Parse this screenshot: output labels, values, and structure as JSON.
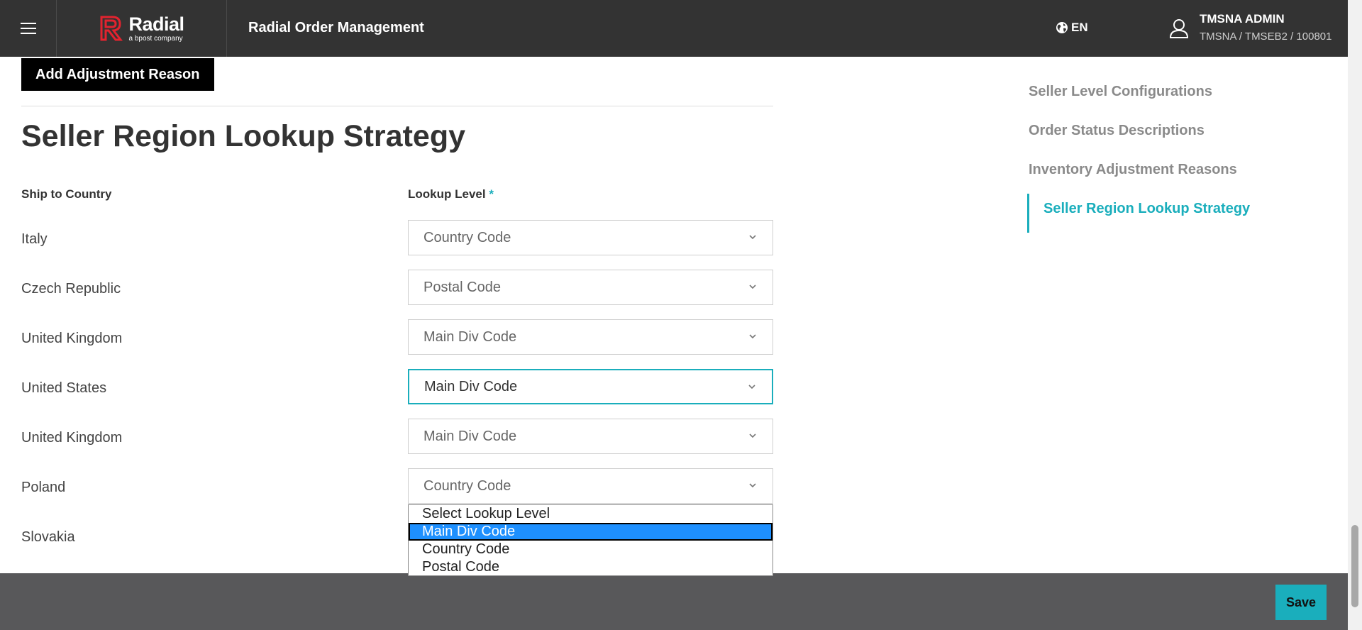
{
  "header": {
    "brand_name": "Radial",
    "brand_sub": "a bpost company",
    "app_title": "Radial Order Management",
    "language": "EN",
    "user_name": "TMSNA ADMIN",
    "user_path": "TMSNA / TMSEB2 / 100801"
  },
  "main": {
    "add_button": "Add Adjustment Reason",
    "section_title": "Seller Region Lookup Strategy",
    "col_ship_to": "Ship to Country",
    "col_lookup": "Lookup Level",
    "required_mark": "*",
    "rows": [
      {
        "country": "Italy",
        "level": "Country Code"
      },
      {
        "country": "Czech Republic",
        "level": "Postal Code"
      },
      {
        "country": "United Kingdom",
        "level": "Main Div Code"
      },
      {
        "country": "United States",
        "level": "Main Div Code"
      },
      {
        "country": "United Kingdom",
        "level": "Main Div Code"
      },
      {
        "country": "Poland",
        "level": "Country Code"
      },
      {
        "country": "Slovakia",
        "level": ""
      }
    ],
    "dropdown_options": [
      "Select Lookup Level",
      "Main Div Code",
      "Country Code",
      "Postal Code"
    ],
    "dropdown_highlighted": "Main Div Code"
  },
  "side_nav": {
    "items": [
      "Seller Level Configurations",
      "Order Status Descriptions",
      "Inventory Adjustment Reasons",
      "Seller Region Lookup Strategy"
    ],
    "active": "Seller Region Lookup Strategy"
  },
  "footer": {
    "save_label": "Save"
  },
  "colors": {
    "accent": "#1aaebc",
    "header_bg": "#333333",
    "footer_bg": "#58585a",
    "brand_red": "#e3232f",
    "option_highlight": "#1e90ff"
  }
}
